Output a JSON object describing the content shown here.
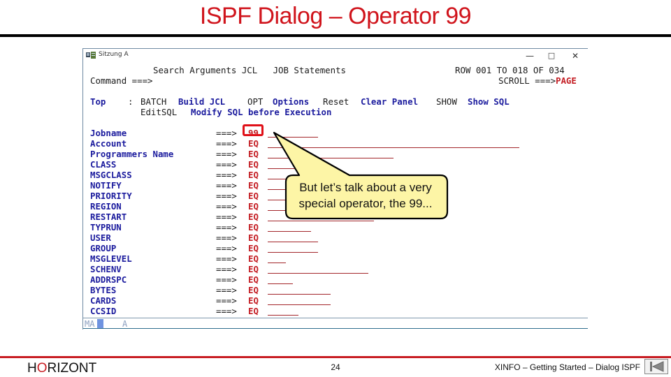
{
  "slide": {
    "title": "ISPF Dialog – Operator 99"
  },
  "window": {
    "app_title": "Sitzung A",
    "app_icon": "terminal-session-icon",
    "minimize_label": "—",
    "maximize_label": "□",
    "close_label": "✕"
  },
  "panel": {
    "heading": "Search Arguments JCL   JOB Statements",
    "row_info": "ROW 001 TO 018 OF 034",
    "command_label": "Command ===>",
    "scroll_label": "SCROLL ===>",
    "scroll_value": "PAGE",
    "top_label": "Top",
    "top_sep": ":",
    "commands": [
      {
        "key": "BATCH",
        "desc": "Build JCL"
      },
      {
        "key": "OPT",
        "desc": "Options"
      },
      {
        "key": "Reset",
        "desc": "Clear Panel"
      },
      {
        "key": "SHOW",
        "desc": "Show SQL"
      },
      {
        "key": "EditSQL",
        "desc": "Modify SQL before Execution"
      }
    ],
    "arrow": "===>",
    "fields": [
      {
        "label": "Jobname",
        "operator": "99",
        "value": ""
      },
      {
        "label": "Account",
        "operator": "EQ",
        "value": ""
      },
      {
        "label": "Programmers Name",
        "operator": "EQ",
        "value": ""
      },
      {
        "label": "CLASS",
        "operator": "EQ",
        "value": ""
      },
      {
        "label": "MSGCLASS",
        "operator": "EQ",
        "value": ""
      },
      {
        "label": "NOTIFY",
        "operator": "EQ",
        "value": ""
      },
      {
        "label": "PRIORITY",
        "operator": "EQ",
        "value": ""
      },
      {
        "label": "REGION",
        "operator": "EQ",
        "value": ""
      },
      {
        "label": "RESTART",
        "operator": "EQ",
        "value": ""
      },
      {
        "label": "TYPRUN",
        "operator": "EQ",
        "value": ""
      },
      {
        "label": "USER",
        "operator": "EQ",
        "value": ""
      },
      {
        "label": "GROUP",
        "operator": "EQ",
        "value": ""
      },
      {
        "label": "MSGLEVEL",
        "operator": "EQ",
        "value": ""
      },
      {
        "label": "SCHENV",
        "operator": "EQ",
        "value": ""
      },
      {
        "label": "ADDRSPC",
        "operator": "EQ",
        "value": ""
      },
      {
        "label": "BYTES",
        "operator": "EQ",
        "value": ""
      },
      {
        "label": "CARDS",
        "operator": "EQ",
        "value": ""
      },
      {
        "label": "CCSID",
        "operator": "EQ",
        "value": ""
      }
    ]
  },
  "statusbar": {
    "indicator": "MA",
    "position_marker": "A"
  },
  "callout": {
    "line1": "But let’s talk about a very",
    "line2": "special operator, the 99..."
  },
  "footer": {
    "logo_prefix": "H",
    "logo_o": "O",
    "logo_suffix": "RIZONT",
    "page_number": "24",
    "doc_title": "XINFO – Getting Started – Dialog ISPF",
    "nav_button": "first-slide-icon"
  },
  "colors": {
    "title_red": "#d0141c",
    "terminal_blue": "#1c1c9e",
    "terminal_red": "#c41e24",
    "callout_fill": "#fdf5a6"
  }
}
